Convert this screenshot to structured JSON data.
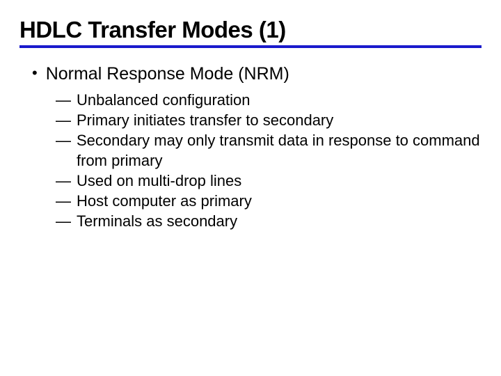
{
  "slide": {
    "title": "HDLC Transfer Modes (1)",
    "bullet": "Normal Response Mode (NRM)",
    "subs": {
      "s0": "Unbalanced configuration",
      "s1": "Primary initiates transfer to secondary",
      "s2": "Secondary may only transmit data in response to command from primary",
      "s3": "Used on multi-drop lines",
      "s4": "Host computer as primary",
      "s5": "Terminals as secondary"
    }
  }
}
